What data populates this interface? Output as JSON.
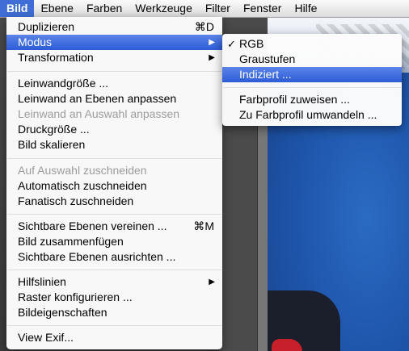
{
  "menubar": {
    "items": [
      "Bild",
      "Ebene",
      "Farben",
      "Werkzeuge",
      "Filter",
      "Fenster",
      "Hilfe"
    ]
  },
  "menu": {
    "items": [
      {
        "label": "Duplizieren",
        "shortcut": "⌘D"
      },
      {
        "label": "Modus",
        "submenu_arrow": "▶"
      },
      {
        "label": "Transformation",
        "submenu_arrow": "▶"
      },
      {
        "label": "Leinwandgröße ..."
      },
      {
        "label": "Leinwand an Ebenen anpassen"
      },
      {
        "label": "Leinwand an Auswahl anpassen",
        "disabled": true
      },
      {
        "label": "Druckgröße ..."
      },
      {
        "label": "Bild skalieren"
      },
      {
        "label": "Auf Auswahl zuschneiden",
        "disabled": true
      },
      {
        "label": "Automatisch zuschneiden"
      },
      {
        "label": "Fanatisch zuschneiden"
      },
      {
        "label": "Sichtbare Ebenen vereinen ...",
        "shortcut": "⌘M"
      },
      {
        "label": "Bild zusammenfügen"
      },
      {
        "label": "Sichtbare Ebenen ausrichten ..."
      },
      {
        "label": "Hilfslinien",
        "submenu_arrow": "▶"
      },
      {
        "label": "Raster konfigurieren ..."
      },
      {
        "label": "Bildeigenschaften"
      },
      {
        "label": "View Exif..."
      }
    ]
  },
  "submenu": {
    "items": [
      {
        "label": "RGB",
        "check": "✓"
      },
      {
        "label": "Graustufen"
      },
      {
        "label": "Indiziert ..."
      },
      {
        "label": "Farbprofil zuweisen ..."
      },
      {
        "label": "Zu Farbprofil umwandeln ..."
      }
    ]
  },
  "colors": {
    "highlight": "#3f6fd6",
    "disabled_text": "#9c9c9c"
  }
}
